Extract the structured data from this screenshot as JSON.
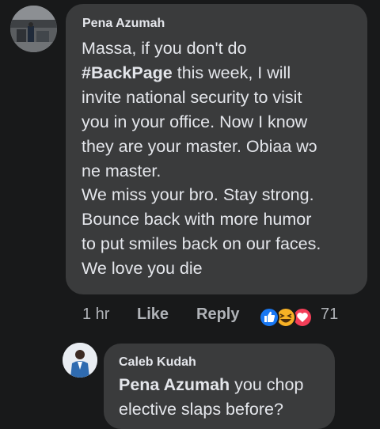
{
  "comment": {
    "author": "Pena Azumah",
    "hashtag": "#BackPage",
    "lines": [
      "Massa, if you don't do",
      " this week, I will",
      "invite national security to visit",
      "you in your office. Now I know",
      "they are your master. Obiaa wɔ",
      "ne master.",
      "We miss your bro. Stay strong.",
      "Bounce back with more humor",
      "to put smiles back on our faces.",
      "We love you die"
    ],
    "time": "1 hr",
    "like_label": "Like",
    "reply_label": "Reply",
    "reaction_count": "71",
    "reaction_icons": [
      "like-icon",
      "haha-icon",
      "love-icon"
    ]
  },
  "reply": {
    "author": "Caleb Kudah",
    "mention": "Pena Azumah",
    "text_first_line": " you chop",
    "text_second_line": "elective slaps before?"
  },
  "colors": {
    "background": "#18191a",
    "bubble": "#3a3b3c",
    "text": "#e4e6eb",
    "meta": "#b0b3b8",
    "like_blue": "#1877f2",
    "haha_yellow": "#f7b125",
    "love_red": "#f33e58"
  }
}
